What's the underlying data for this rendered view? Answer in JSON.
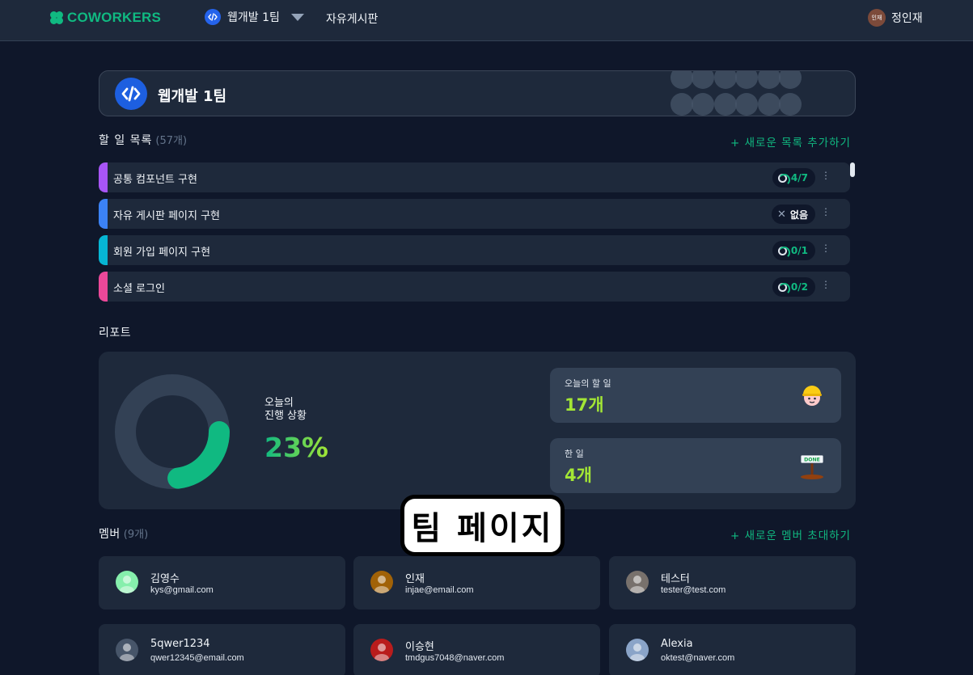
{
  "brand": {
    "name": "COWORKERS",
    "color": "#10b981"
  },
  "nav": {
    "team_name": "웹개발 1팀",
    "board_link": "자유게시판",
    "user_avatar_text": "인재",
    "user_name": "정인재"
  },
  "team": {
    "title": "웹개발 1팀"
  },
  "tasks": {
    "heading": "할 일 목록",
    "count": "(57개)",
    "add_label": "+ 새로운 목록 추가하기",
    "items": [
      {
        "label": "공통 컴포넌트 구현",
        "badge": "4/7",
        "color": "#a855f7",
        "progress": 0.57
      },
      {
        "label": "자유 게시판 페이지 구현",
        "badge": "없음",
        "color": "#3b82f6",
        "progress": 0
      },
      {
        "label": "회원 가입 페이지 구현",
        "badge": "0/1",
        "color": "#06b6d4",
        "progress": 0
      },
      {
        "label": "소셜 로그인",
        "badge": "0/2",
        "color": "#ec4899",
        "progress": 0
      }
    ]
  },
  "report": {
    "heading": "리포트",
    "progress_label_line1": "오늘의",
    "progress_label_line2": "진행 상황",
    "progress_pct": "23%",
    "progress_value": 0.23,
    "today_label": "오늘의 할 일",
    "today_value": "17개",
    "done_label": "한 일",
    "done_value": "4개",
    "done_sign": "DONE"
  },
  "members": {
    "heading": "멤버",
    "count": "(9개)",
    "invite_label": "+ 새로운 멤버 초대하기",
    "items": [
      {
        "name": "김영수",
        "email": "kys@gmail.com",
        "avatar": "#86efac"
      },
      {
        "name": "인재",
        "email": "injae@email.com",
        "avatar": "#a16207"
      },
      {
        "name": "테스터",
        "email": "tester@test.com",
        "avatar": "#78716c"
      },
      {
        "name": "5qwer1234",
        "email": "qwer12345@email.com",
        "avatar": "#475569"
      },
      {
        "name": "이승현",
        "email": "tmdgus7048@naver.com",
        "avatar": "#b91c1c"
      },
      {
        "name": "Alexia",
        "email": "oktest@naver.com",
        "avatar": "#8aa4c8"
      }
    ]
  },
  "overlay_caption": "팀 페이지"
}
